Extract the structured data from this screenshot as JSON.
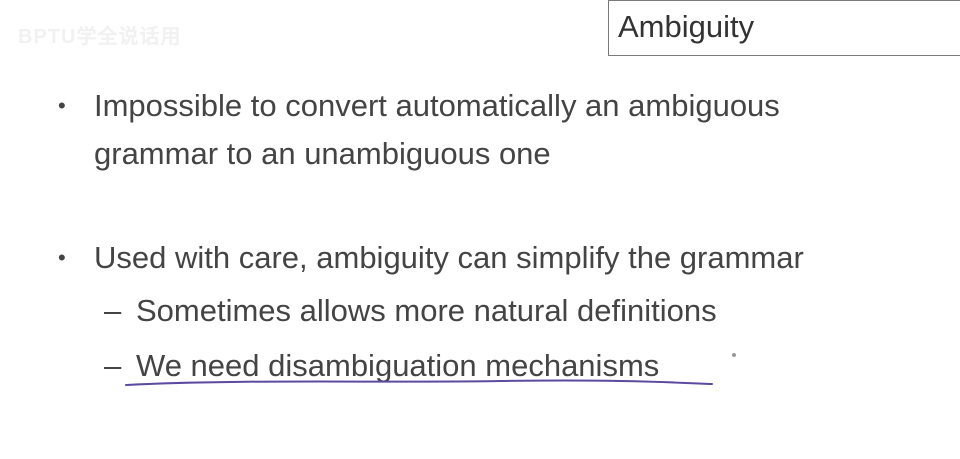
{
  "watermark": "BPTU学全说话用",
  "slide": {
    "title": "Ambiguity",
    "bullets": [
      {
        "marker": "•",
        "lines": [
          "Impossible to convert automatically an ambiguous",
          "grammar to an unambiguous one"
        ]
      },
      {
        "marker": "•",
        "lines": [
          "Used with care, ambiguity can simplify the grammar"
        ],
        "subitems": [
          {
            "marker": "–",
            "text": "Sometimes allows more natural definitions"
          },
          {
            "marker": "–",
            "text": "We need disambiguation mechanisms"
          }
        ]
      }
    ]
  },
  "colors": {
    "text": "#444444",
    "annotation_ink": "#5b4aa0",
    "title_border": "#7a7a7a"
  }
}
